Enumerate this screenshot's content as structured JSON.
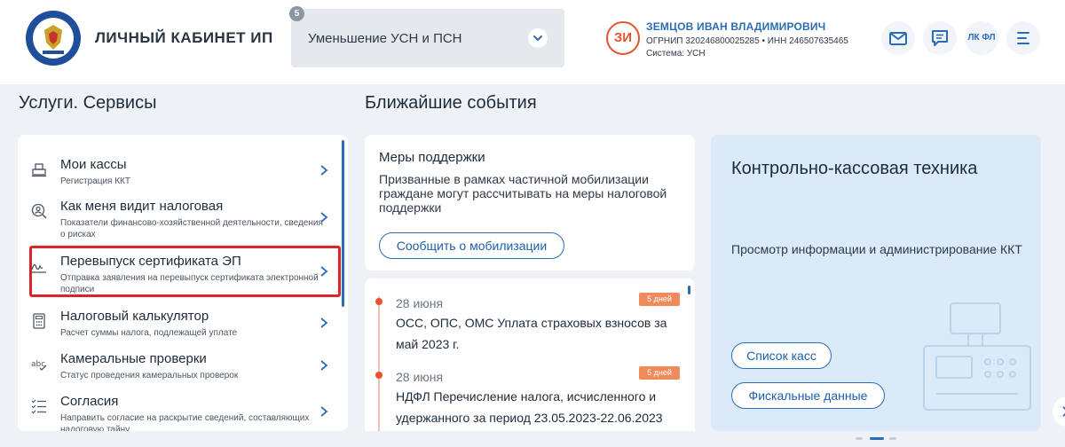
{
  "header": {
    "title": "ЛИЧНЫЙ КАБИНЕТ ИП",
    "mode_select": {
      "badge": "5",
      "value": "Уменьшение УСН и ПСН"
    },
    "user": {
      "initials": "ЗИ",
      "name": "ЗЕМЦОВ ИВАН ВЛАДИМИРОВИЧ",
      "ids": "ОГРНИП 320246800025285 • ИНН 246507635465",
      "system": "Система: УСН"
    },
    "buttons": {
      "lk_fl": "ЛК ФЛ"
    }
  },
  "services": {
    "title": "Услуги. Сервисы",
    "items": [
      {
        "title": "Мои кассы",
        "subtitle": "Регистрация ККТ",
        "icon": "cash-register-icon"
      },
      {
        "title": "Как меня видит налоговая",
        "subtitle": "Показатели финансово-хозяйственной деятельности, сведения о рисках",
        "icon": "magnifier-person-icon"
      },
      {
        "title": "Перевыпуск сертификата ЭП",
        "subtitle": "Отправка заявления на перевыпуск сертификата электронной подписи",
        "icon": "signature-icon"
      },
      {
        "title": "Налоговый калькулятор",
        "subtitle": "Расчет суммы налога, подлежащей уплате",
        "icon": "calculator-icon"
      },
      {
        "title": "Камеральные проверки",
        "subtitle": "Статус проведения камеральных проверок",
        "icon": "abc-check-icon"
      },
      {
        "title": "Согласия",
        "subtitle": "Направить согласие на раскрытие сведений, составляющих налоговую тайну",
        "icon": "checklist-icon"
      }
    ]
  },
  "events": {
    "title": "Ближайшие события",
    "support": {
      "title": "Меры поддержки",
      "text": "Призванные в рамках частичной мобилизации граждане могут рассчитывать на меры налоговой поддержки",
      "button": "Сообщить о мобилизации"
    },
    "items": [
      {
        "date": "28 июня",
        "badge": "5 дней",
        "text": "ОСС, ОПС, ОМС Уплата страховых взносов за май 2023 г."
      },
      {
        "date": "28 июня",
        "badge": "5 дней",
        "text": "НДФЛ Перечисление налога, исчисленного и удержанного за период 23.05.2023-22.06.2023"
      }
    ]
  },
  "kkt": {
    "title": "Контрольно-кассовая техника",
    "description": "Просмотр информации и администрирование ККТ",
    "buttons": [
      "Список касс",
      "Фискальные данные"
    ]
  },
  "colors": {
    "accent": "#2a6db5",
    "highlight": "#d9252a",
    "badge": "#f08a5a",
    "avatar": "#e8532b",
    "kkt_bg": "#dbeaf8"
  }
}
